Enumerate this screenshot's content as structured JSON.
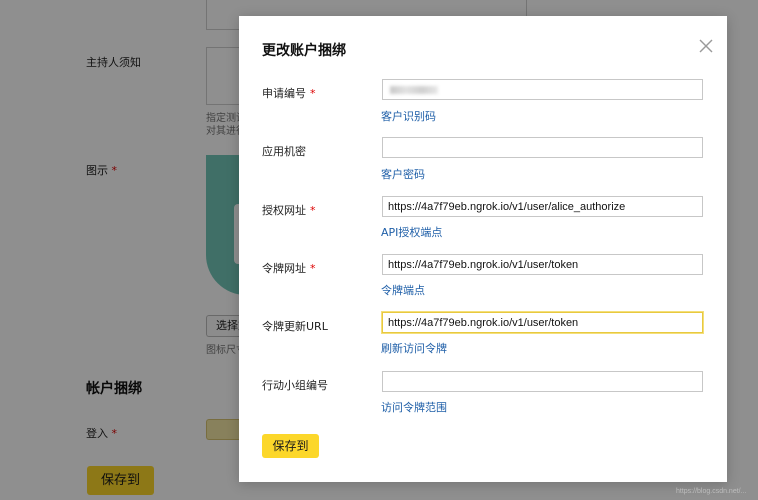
{
  "background_page": {
    "host_notes_label": "主持人须知",
    "icon_label": "图示",
    "required_mark": "*",
    "hint_line1": "指定测试",
    "hint_line2": "对其进行",
    "choose_button_label": "选择文件",
    "icon_size_hint": "图标尺寸",
    "account_section_title": "帐户捆绑",
    "login_label": "登入",
    "save_button_label": "保存到"
  },
  "modal": {
    "title": "更改账户捆绑",
    "close_icon": "close-icon",
    "required_mark": "*",
    "fields": [
      {
        "label": "申请编号",
        "required": true,
        "value": "",
        "hint": "客户识别码"
      },
      {
        "label": "应用机密",
        "required": false,
        "value": "",
        "hint": "客户密码"
      },
      {
        "label": "授权网址",
        "required": true,
        "value": "https://4a7f79eb.ngrok.io/v1/user/alice_authorize",
        "hint": "API授权端点"
      },
      {
        "label": "令牌网址",
        "required": true,
        "value": "https://4a7f79eb.ngrok.io/v1/user/token",
        "hint": "令牌端点"
      },
      {
        "label": "令牌更新URL",
        "required": false,
        "value": "https://4a7f79eb.ngrok.io/v1/user/token",
        "hint": "刷新访问令牌"
      },
      {
        "label": "行动小组编号",
        "required": false,
        "value": "",
        "hint": "访问令牌范围"
      }
    ],
    "save_button_label": "保存到"
  },
  "colors": {
    "accent_yellow": "#fcd72a",
    "link_blue": "#1f5fa8",
    "required_red": "#dd0000",
    "focus_border": "#e8c93f"
  },
  "watermark": "https://blog.csdn.net/..."
}
